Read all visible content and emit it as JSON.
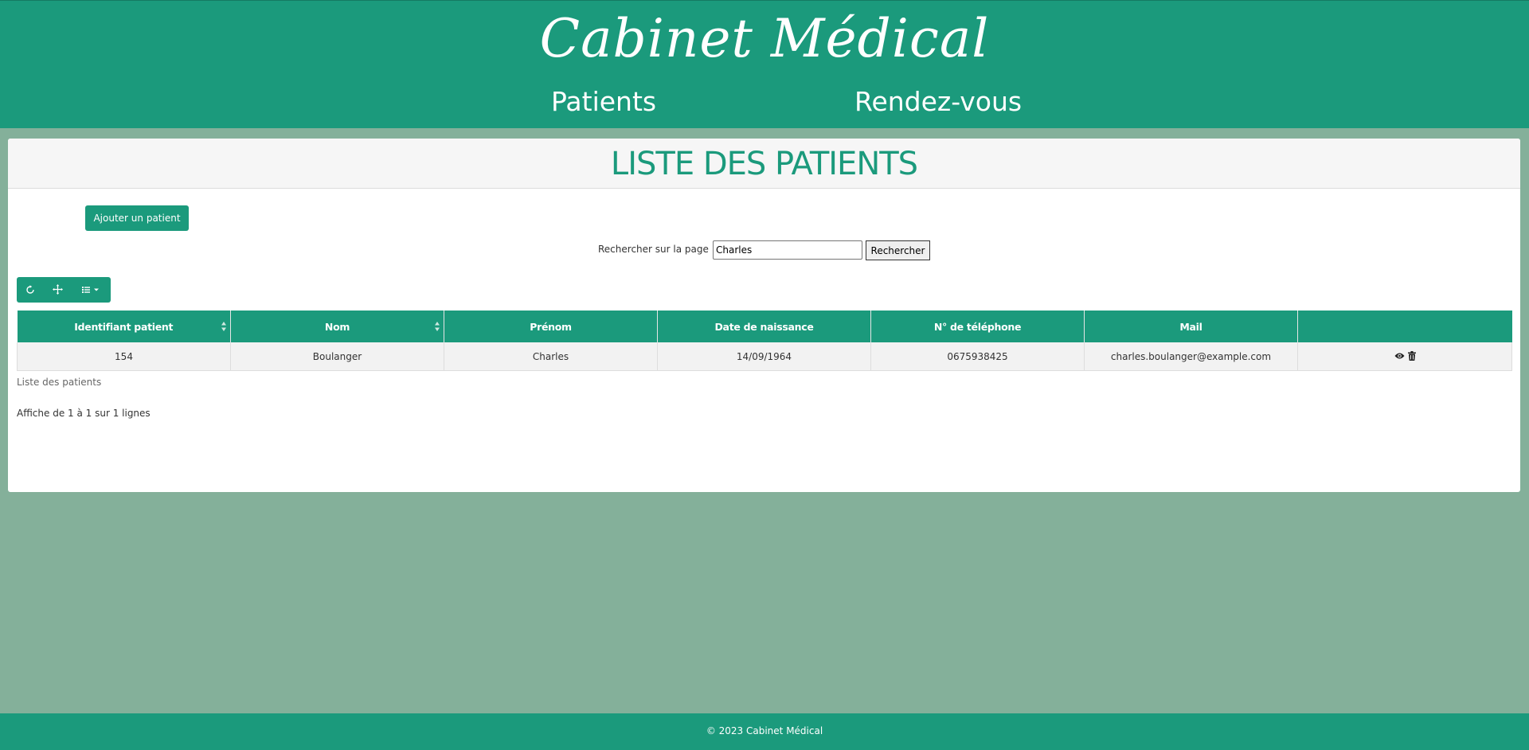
{
  "header": {
    "brand": "Cabinet Médical",
    "nav": [
      {
        "label": "Patients"
      },
      {
        "label": "Rendez-vous"
      }
    ]
  },
  "page": {
    "title": "LISTE DES PATIENTS",
    "add_button": "Ajouter un patient",
    "search": {
      "label": "Rechercher sur la page :",
      "value": "Charles",
      "button": "Rechercher"
    },
    "toolbar": {
      "icons": [
        "refresh-icon",
        "move-icon",
        "columns-list-icon"
      ]
    },
    "table": {
      "columns": [
        {
          "label": "Identifiant patient",
          "sortable": true
        },
        {
          "label": "Nom",
          "sortable": true
        },
        {
          "label": "Prénom",
          "sortable": false
        },
        {
          "label": "Date de naissance",
          "sortable": false
        },
        {
          "label": "N° de téléphone",
          "sortable": false
        },
        {
          "label": "Mail",
          "sortable": false
        },
        {
          "label": "",
          "sortable": false
        }
      ],
      "rows": [
        {
          "id": "154",
          "nom": "Boulanger",
          "prenom": "Charles",
          "date_naissance": "14/09/1964",
          "telephone": "0675938425",
          "mail": "charles.boulanger@example.com",
          "actions": [
            "eye-icon",
            "trash-icon"
          ]
        }
      ]
    },
    "caption": "Liste des patients",
    "pagination_info": "Affiche de 1 à 1 sur 1 lignes"
  },
  "footer": {
    "text": "© 2023 Cabinet Médical"
  },
  "colors": {
    "primary": "#1b9a7c",
    "background": "#84b09a",
    "card": "#ffffff",
    "card_header": "#f6f6f6",
    "row": "#f2f2f2"
  }
}
